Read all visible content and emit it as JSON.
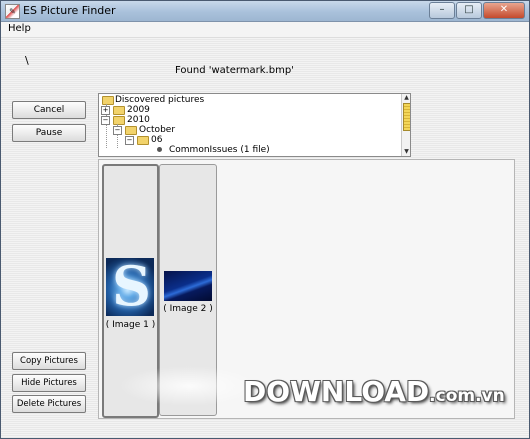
{
  "window": {
    "title": "ES Picture Finder",
    "controls": {
      "minimize": "–",
      "maximize": "□",
      "close": "✕"
    }
  },
  "menu": {
    "help": "Help"
  },
  "status": {
    "path": "\\",
    "found": "Found 'watermark.bmp'"
  },
  "buttons": {
    "cancel": "Cancel",
    "pause": "Pause",
    "copy": "Copy Pictures",
    "hide": "Hide Pictures",
    "delete": "Delete Pictures"
  },
  "tree": {
    "root": "Discovered pictures",
    "nodes": [
      {
        "label": "2009",
        "expander": "+"
      },
      {
        "label": "2010",
        "expander": "−"
      },
      {
        "label": "October",
        "expander": "−"
      },
      {
        "label": "06",
        "expander": "−"
      },
      {
        "label": "CommonIssues (1 file)"
      }
    ]
  },
  "gallery": {
    "images": [
      {
        "caption": "( Image 1 )"
      },
      {
        "caption": "( Image 2 )"
      }
    ]
  },
  "watermark": {
    "text": "DOWNLOAD",
    "suffix": ".com.vn"
  },
  "colors": {
    "titlebar": "#a9c1db",
    "tree_scroll_thumb": "#f3d657",
    "close_button": "#c44a2c"
  }
}
